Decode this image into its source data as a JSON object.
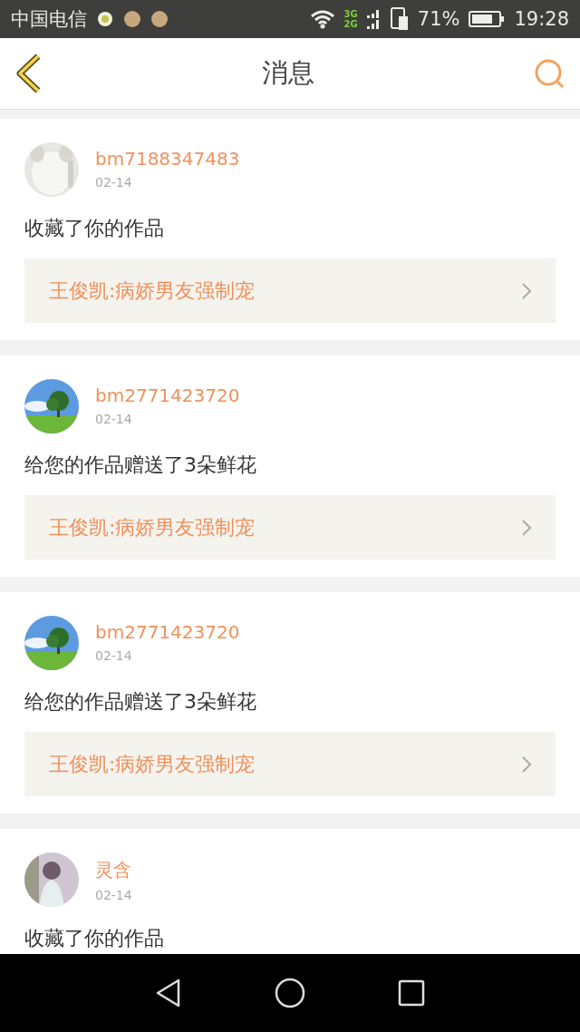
{
  "status_bar": {
    "carrier": "中国电信",
    "network_top": "3G",
    "network_bottom": "2G",
    "battery": "71%",
    "time": "19:28"
  },
  "header": {
    "title": "消息"
  },
  "messages": [
    {
      "user": "bm7188347483",
      "date": "02-14",
      "text": "收藏了你的作品",
      "work": "王俊凯:病娇男友强制宠"
    },
    {
      "user": "bm2771423720",
      "date": "02-14",
      "text": "给您的作品赠送了3朵鲜花",
      "work": "王俊凯:病娇男友强制宠"
    },
    {
      "user": "bm2771423720",
      "date": "02-14",
      "text": "给您的作品赠送了3朵鲜花",
      "work": "王俊凯:病娇男友强制宠"
    },
    {
      "user": "灵含",
      "date": "02-14",
      "text": "收藏了你的作品"
    }
  ]
}
